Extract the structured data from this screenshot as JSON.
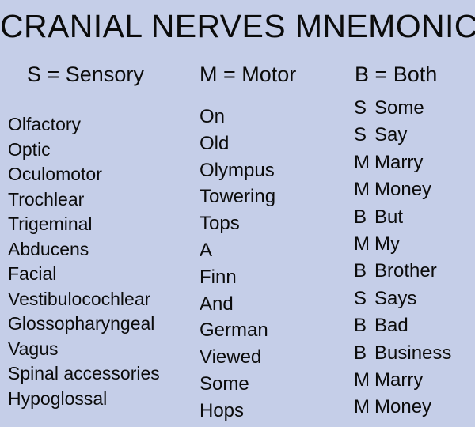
{
  "poster": {
    "title": "CRANIAL NERVES MNEMONIC",
    "background_color": "#c5cee8",
    "text_color": "#0b0b0b"
  },
  "legend": {
    "sensory": "S = Sensory",
    "motor": "M = Motor",
    "both": "B = Both"
  },
  "columns": {
    "nerves": [
      "Olfactory",
      "Optic",
      "Oculomotor",
      "Trochlear",
      "Trigeminal",
      "Abducens",
      "Facial",
      "Vestibulocochlear",
      "Glossopharyngeal",
      "Vagus",
      "Spinal accessories",
      "Hypoglossal"
    ],
    "mnemonic": [
      "On",
      "Old",
      "Olympus",
      "Towering",
      "Tops",
      "A",
      "Finn",
      "And",
      "German",
      "Viewed",
      "Some",
      "Hops"
    ],
    "types": [
      {
        "letter": "S",
        "word": "Some"
      },
      {
        "letter": "S",
        "word": "Say"
      },
      {
        "letter": "M",
        "word": "Marry"
      },
      {
        "letter": "M",
        "word": "Money"
      },
      {
        "letter": "B",
        "word": "But"
      },
      {
        "letter": "M",
        "word": "My"
      },
      {
        "letter": "B",
        "word": "Brother"
      },
      {
        "letter": "S",
        "word": "Says"
      },
      {
        "letter": "B",
        "word": "Bad"
      },
      {
        "letter": "B",
        "word": "Business"
      },
      {
        "letter": "M",
        "word": "Marry"
      },
      {
        "letter": "M",
        "word": "Money"
      }
    ]
  }
}
